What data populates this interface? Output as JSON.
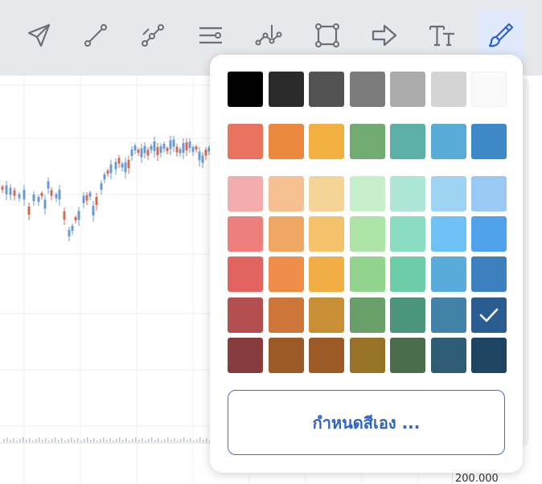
{
  "toolbar": {
    "tools": [
      {
        "name": "cursor-arrow-icon",
        "active": false
      },
      {
        "name": "trend-line-icon",
        "active": false
      },
      {
        "name": "multi-point-line-icon",
        "active": false
      },
      {
        "name": "parallel-lines-icon",
        "active": false
      },
      {
        "name": "pattern-icon",
        "active": false
      },
      {
        "name": "rectangle-icon",
        "active": false
      },
      {
        "name": "arrow-icon",
        "active": false
      },
      {
        "name": "text-icon",
        "active": false
      },
      {
        "name": "brush-icon",
        "active": true
      }
    ],
    "icon_color": "#6b6e78",
    "active_color": "#2962d6"
  },
  "chart": {
    "price_label": "200.000"
  },
  "color_picker": {
    "rows": [
      [
        "#000000",
        "#2a2a2a",
        "#525252",
        "#7c7c7c",
        "#ababab",
        "#d4d4d4",
        "#fafafa"
      ],
      [
        "#e8735f",
        "#ec8840",
        "#f2b041",
        "#71ab71",
        "#5cb0a8",
        "#5aacd8",
        "#3f88c8"
      ],
      [
        "#f2adac",
        "#f7c090",
        "#f5d597",
        "#c8efcc",
        "#ade5d6",
        "#9ed3f4",
        "#99c9f4"
      ],
      [
        "#ef7f7d",
        "#f0a764",
        "#f3c26a",
        "#afe4a8",
        "#8adcc3",
        "#6ec1f4",
        "#50a2ec"
      ],
      [
        "#e2635f",
        "#ee8c48",
        "#f2ad45",
        "#92d48d",
        "#6bcca8",
        "#59abdb",
        "#3d80c0"
      ],
      [
        "#b44f4f",
        "#cd7639",
        "#c98f37",
        "#6b9f6a",
        "#4a957b",
        "#4282a9",
        "#2b5c91"
      ],
      [
        "#863c3c",
        "#9c5a26",
        "#9c5a27",
        "#977227",
        "#4b6d4c",
        "#2e5c74",
        "#1e4461"
      ]
    ],
    "selected": {
      "row": 5,
      "col": 6
    },
    "custom_label": "กำหนดสีเอง ..."
  }
}
